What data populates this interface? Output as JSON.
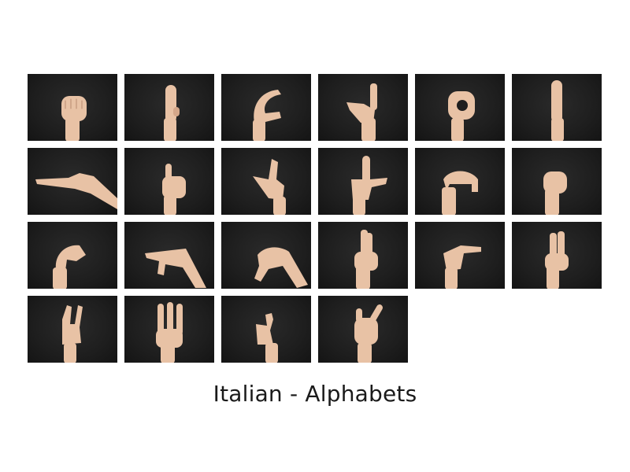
{
  "caption": "Italian - Alphabets",
  "colors": {
    "background": "#ffffff",
    "tile_background": "#1e1e1e",
    "skin": "#e8c2a5",
    "caption_text": "#1a1a1a"
  },
  "tiles": [
    {
      "icon": "fist-hand-icon"
    },
    {
      "icon": "flat-hand-side-icon"
    },
    {
      "icon": "c-curve-hand-icon"
    },
    {
      "icon": "thumb-index-l-hand-icon"
    },
    {
      "icon": "o-shape-hand-icon"
    },
    {
      "icon": "flat-hand-edge-icon"
    },
    {
      "icon": "pointing-left-hand-icon"
    },
    {
      "icon": "thumb-up-fist-hand-icon"
    },
    {
      "icon": "index-thumb-point-hand-icon"
    },
    {
      "icon": "index-up-l-hand-icon"
    },
    {
      "icon": "fingers-down-hand-icon"
    },
    {
      "icon": "fingers-down-fist-hand-icon"
    },
    {
      "icon": "curled-fingers-hand-icon"
    },
    {
      "icon": "pointing-left-down-hand-icon"
    },
    {
      "icon": "two-fingers-down-hand-icon"
    },
    {
      "icon": "crossed-fingers-hand-icon"
    },
    {
      "icon": "pointing-right-hand-icon"
    },
    {
      "icon": "two-fingers-up-hand-icon"
    },
    {
      "icon": "v-sign-hand-icon"
    },
    {
      "icon": "three-fingers-hand-icon"
    },
    {
      "icon": "hook-index-hand-icon"
    },
    {
      "icon": "horns-hand-icon"
    }
  ]
}
